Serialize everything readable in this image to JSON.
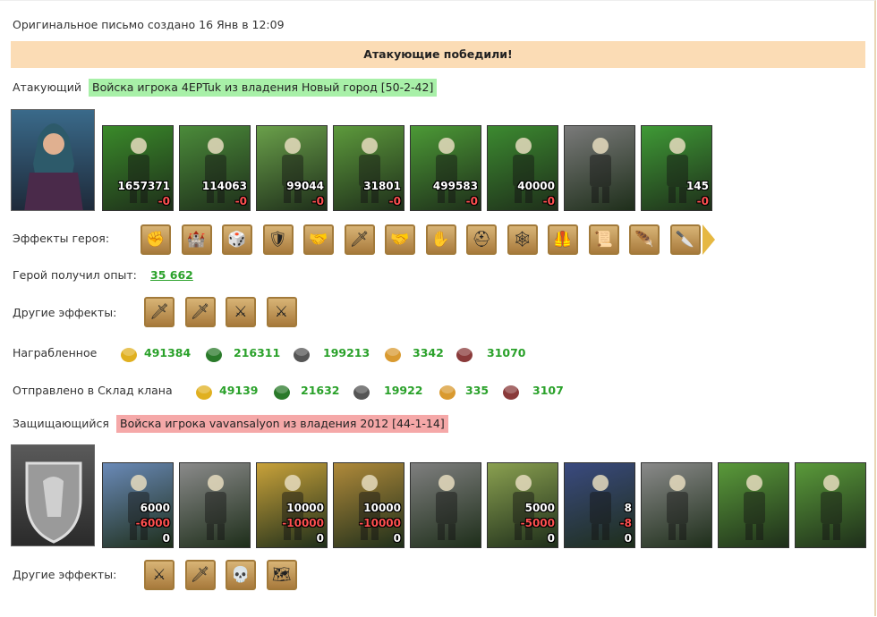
{
  "header": {
    "text": "Оригинальное письмо создано 16 Янв в 12:09"
  },
  "banner": {
    "text": "Атакующие победили!"
  },
  "attacker": {
    "label": "Атакующий",
    "tag": "Войска игрока 4EPTuk из владения Новый город [50-2-42]",
    "units": [
      {
        "a": "1657371",
        "b": "-0",
        "c": "1657371",
        "color": "#3a8a2a",
        "icon": "goblin-warrior"
      },
      {
        "a": "114063",
        "b": "-0",
        "c": "114063",
        "color": "#4b8b3a",
        "icon": "orc-spearman"
      },
      {
        "a": "99044",
        "b": "-0",
        "c": "99044",
        "color": "#6aa04a",
        "icon": "elf-ranger"
      },
      {
        "a": "31801",
        "b": "-0",
        "c": "31801",
        "color": "#5d9a3c",
        "icon": "winged-beast"
      },
      {
        "a": "499583",
        "b": "-0",
        "c": "499583",
        "color": "#4c9a36",
        "icon": "archer"
      },
      {
        "a": "40000",
        "b": "-0",
        "c": "40000",
        "color": "#3c8a30",
        "icon": "druid"
      },
      {
        "a": "",
        "b": "",
        "c": "",
        "color": "#7a7a7a",
        "icon": "grey-wraith"
      },
      {
        "a": "145",
        "b": "-0",
        "c": "145",
        "color": "#3f9a36",
        "icon": "green-mage"
      }
    ]
  },
  "hero_effects": {
    "label": "Эффекты героя:",
    "icons": [
      "hand-coins-icon",
      "fortress-icon",
      "dice-icon",
      "shield-icon",
      "handshake-shield-icon",
      "sword-icon",
      "handshake-icon",
      "hand-icon",
      "helmet-icon",
      "web-icon",
      "armor-icon",
      "scroll-icon",
      "feather-icon",
      "dagger-icon"
    ],
    "glyphs": [
      "✊",
      "🏰",
      "🎲",
      "🛡",
      "🤝",
      "🗡",
      "🤝",
      "✋",
      "⛑",
      "🕸",
      "🦺",
      "📜",
      "🪶",
      "🔪"
    ]
  },
  "experience": {
    "label": "Герой получил опыт:",
    "value": "35 662"
  },
  "other_effects_attacker": {
    "label": "Другие эффекты:",
    "icons": [
      "sword-icon",
      "sword-icon",
      "fist-sword-icon",
      "fist-sword-icon"
    ],
    "glyphs": [
      "🗡",
      "🗡",
      "⚔",
      "⚔"
    ]
  },
  "loot": {
    "label": "Награбленное",
    "items": [
      {
        "icon": "gold-icon",
        "value": "491384"
      },
      {
        "icon": "wood-icon",
        "value": "216311"
      },
      {
        "icon": "ore-icon",
        "value": "199213"
      },
      {
        "icon": "grain-icon",
        "value": "3342"
      },
      {
        "icon": "brick-icon",
        "value": "31070"
      }
    ]
  },
  "clan_storage": {
    "label": "Отправлено в Склад клана",
    "items": [
      {
        "icon": "gold-icon",
        "value": "49139"
      },
      {
        "icon": "wood-icon",
        "value": "21632"
      },
      {
        "icon": "ore-icon",
        "value": "19922"
      },
      {
        "icon": "grain-icon",
        "value": "335"
      },
      {
        "icon": "brick-icon",
        "value": "3107"
      }
    ]
  },
  "defender": {
    "label": "Защищающийся",
    "tag": "Войска игрока vavansalyon из владения 2012 [44-1-14]",
    "units": [
      {
        "a": "6000",
        "b": "-6000",
        "c": "0",
        "color": "#6a8ab8",
        "icon": "knight-archer"
      },
      {
        "a": "",
        "b": "",
        "c": "",
        "color": "#8a8a8a",
        "icon": "grey-crossbowman"
      },
      {
        "a": "10000",
        "b": "-10000",
        "c": "0",
        "color": "#c9a23a",
        "icon": "golden-cavalry"
      },
      {
        "a": "10000",
        "b": "-10000",
        "c": "0",
        "color": "#b08a3a",
        "icon": "griffin-rider"
      },
      {
        "a": "",
        "b": "",
        "c": "",
        "color": "#7f7f7f",
        "icon": "grey-gunner"
      },
      {
        "a": "5000",
        "b": "-5000",
        "c": "0",
        "color": "#8aa050",
        "icon": "monk"
      },
      {
        "a": "8",
        "b": "-8",
        "c": "0",
        "color": "#3a4a80",
        "icon": "blade-warrior"
      },
      {
        "a": "",
        "b": "",
        "c": "",
        "color": "#8a8a8a",
        "icon": "grey-reaper"
      },
      {
        "a": "",
        "b": "",
        "c": "",
        "color": "#5a9a3a",
        "icon": "green-tower"
      },
      {
        "a": "",
        "b": "",
        "c": "",
        "color": "#5a9a3a",
        "icon": "green-tower"
      }
    ]
  },
  "other_effects_defender": {
    "label": "Другие эффекты:",
    "icons": [
      "fist-sword-icon",
      "sword-icon",
      "skeleton-icon",
      "map-icon"
    ],
    "glyphs": [
      "⚔",
      "🗡",
      "💀",
      "🗺"
    ]
  }
}
